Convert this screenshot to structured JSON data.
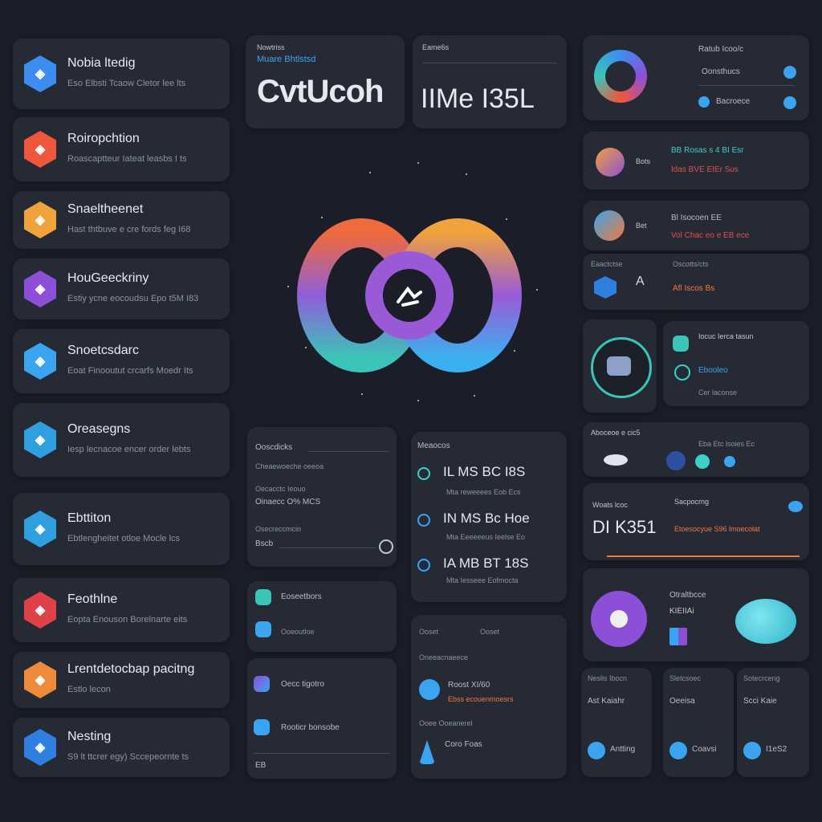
{
  "left_list": [
    {
      "title": "Nobia ltedig",
      "sub": "Eso Elbsti Tcaow  Cletor lee lts",
      "color": "#3b8ef0"
    },
    {
      "title": "Roiropchtion",
      "sub": "Roascaptteur  Iateat leasbs I ts",
      "color": "#f0563b"
    },
    {
      "title": "Snaeltheenet",
      "sub": "Hast thtbuve  e cre fords feg I68",
      "color": "#f0a23b"
    },
    {
      "title": "HouGeeckriny",
      "sub": "Estiy ycne  eocoudsu  Epo t5M I83",
      "color": "#8e4fd8"
    },
    {
      "title": "Snoetcsdarc",
      "sub": "Eoat Finooutut  crcarfs Moedr Its",
      "color": "#3ba4f0"
    },
    {
      "title": "Oreasegns",
      "sub": "Iesp  lecnacoe  encer  order  lebts",
      "color": "#2f9fe0"
    },
    {
      "title": "Ebttiton",
      "sub": "Ebtlengheitet  otloe  Mocle lcs",
      "color": "#2f9fe0"
    },
    {
      "title": "Feothlne",
      "sub": "Eopta Enouson  Borelnarte eits",
      "color": "#e0404a"
    },
    {
      "title": "Lrentdetocbap  pacitng",
      "sub": "Estlo lecon",
      "color": "#f08a3b"
    },
    {
      "title": "Nesting",
      "sub": "S9 lt ttcrer egy)  Sccepeornte ts",
      "color": "#2f7fe0"
    }
  ],
  "top_card_1": {
    "label1": "Nowtriss",
    "label2": "Muare Bhtlstsd",
    "big": "CvtUcoh"
  },
  "top_card_2": {
    "label": "Eame6s",
    "big": "IIMe I35L"
  },
  "right_top": {
    "title": "Ratub Icoo/c",
    "rows": [
      "Oonsthucs",
      "Bacroece"
    ]
  },
  "right_card_2": {
    "r1": "BB  Rosas s 4  BI  Esr",
    "r2": "Idas  BVE  EIEr  Sus",
    "side": "Bots"
  },
  "right_card_3": {
    "r1": "Bl Isocoen  EE",
    "r2": "Vol  Chac eo e  EB  ece",
    "side": "Bet"
  },
  "right_card_4": {
    "t1": "Eaactctse",
    "t2": "Oscotts/cts",
    "r1": "A",
    "r2": "Afl Iscos  Bs"
  },
  "right_card_5": {
    "r1": "Iocuc  Ierca tasun",
    "r2": "Ebooleo",
    "r3": "Cer  laconse"
  },
  "right_card_6": {
    "t1": "Aboceoe e cic5",
    "t2": "Eba   Etc  lsoies Ec"
  },
  "right_card_7": {
    "t1": "Woats lcoc",
    "t2": "Sacpocrng",
    "big": "DI K351",
    "row": "Etoesocyue  S96 lmoecolat"
  },
  "right_card_8": {
    "t1": "Otraltbcce",
    "t2": "KIEIIAi"
  },
  "mini_cards": [
    {
      "t": "Neslis Ibocn",
      "r": "Ast  Kaiahr",
      "b": "Antting"
    },
    {
      "t": "Sletcsoec",
      "r": "Oeeisa",
      "b": "Coavsi"
    },
    {
      "t": "Sotecrceng",
      "r": "Scci Kaie",
      "b": "I1eS2"
    }
  ],
  "mid_panel_1": {
    "title": "Ooscdicks",
    "r1": "Cheaewoeche  oeeoa",
    "r2": "Oecacctc  Ieouo",
    "r3": "Oinaecc   O%  MCS",
    "r4": "Osecreccmcin",
    "r5": "Bscb"
  },
  "mid_panel_2": {
    "title": "Meaocos",
    "rows": [
      "IL  MS   BC I8S",
      "Mta  reweeees  Eob  Ecs",
      "IN  MS   Bc Hoe",
      "Mta  Eeeeeeus  Ieelse  Eo",
      "IA  MB   BT 18S",
      "Mta  Iesseee  Eofmocta"
    ]
  },
  "mid_panel_3": {
    "r1": "Eoseetbors",
    "r2": "Ooeoutloe"
  },
  "mid_panel_4": {
    "title": "Oneeacnaeece",
    "h1": "Ooset",
    "r1": "Roost  XI/60",
    "r2": "Ebss  ecouenmoesrs",
    "r3": "Ooee  Ooeanerel",
    "r4": "Coro  Foas"
  },
  "mid_panel_5": {
    "r1": "Oecc  tigotro",
    "r2": "Rooticr  bonsobe"
  },
  "bottom_mid": "EB",
  "colors": {
    "accent": "#3ba4f0",
    "orange": "#f07a3b",
    "purple": "#8e4fd8",
    "teal": "#3bd0c8"
  }
}
